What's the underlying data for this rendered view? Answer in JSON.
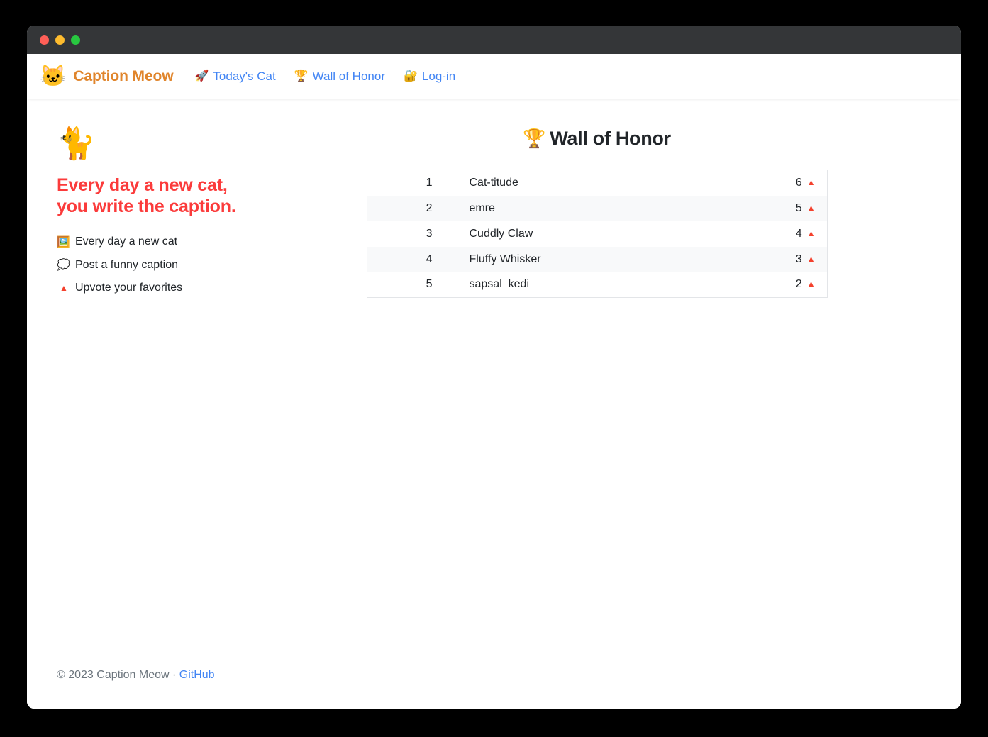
{
  "window": {
    "traffic_lights": [
      {
        "name": "close",
        "color": "#ff5f57"
      },
      {
        "name": "minimize",
        "color": "#febc2e"
      },
      {
        "name": "maximize",
        "color": "#28c840"
      }
    ]
  },
  "navbar": {
    "brand": {
      "icon": "cat-face-icon",
      "glyph": "🐱",
      "label": "Caption Meow",
      "color": "#e0852c"
    },
    "links": [
      {
        "name": "todays-cat",
        "icon": "rocket-icon",
        "glyph": "🚀",
        "label": "Today's Cat"
      },
      {
        "name": "wall-of-honor",
        "icon": "trophy-icon",
        "glyph": "🏆",
        "label": "Wall of Honor"
      },
      {
        "name": "log-in",
        "icon": "lock-icon",
        "glyph": "🔐",
        "label": "Log-in"
      }
    ],
    "link_color": "#4285f4"
  },
  "sidebar": {
    "hero_icon": "walking-cat-icon",
    "hero_glyph": "🐈",
    "headline_line1": "Every day a new cat,",
    "headline_line2": "you write the caption.",
    "headline_color": "#fb3b3b",
    "features": [
      {
        "name": "feature-new-cat",
        "icon": "framed-picture-icon",
        "glyph": "🖼️",
        "label": "Every day a new cat"
      },
      {
        "name": "feature-caption",
        "icon": "thought-balloon-icon",
        "glyph": "💭",
        "label": "Post a funny caption"
      },
      {
        "name": "feature-upvote",
        "icon": "up-triangle-icon",
        "glyph": "▲",
        "label": "Upvote your favorites"
      }
    ]
  },
  "main": {
    "section_title": {
      "icon": "trophy-icon",
      "glyph": "🏆",
      "label": "Wall of Honor"
    },
    "leaderboard": {
      "rows": [
        {
          "rank": "1",
          "name": "Cat-titude",
          "votes": "6",
          "arrow": "▲"
        },
        {
          "rank": "2",
          "name": "emre",
          "votes": "5",
          "arrow": "▲"
        },
        {
          "rank": "3",
          "name": "Cuddly Claw",
          "votes": "4",
          "arrow": "▲"
        },
        {
          "rank": "4",
          "name": "Fluffy Whisker",
          "votes": "3",
          "arrow": "▲"
        },
        {
          "rank": "5",
          "name": "sapsal_kedi",
          "votes": "2",
          "arrow": "▲"
        }
      ],
      "arrow_color": "#f4412d"
    }
  },
  "footer": {
    "copyright": "© 2023 Caption Meow · ",
    "link_label": "GitHub"
  }
}
